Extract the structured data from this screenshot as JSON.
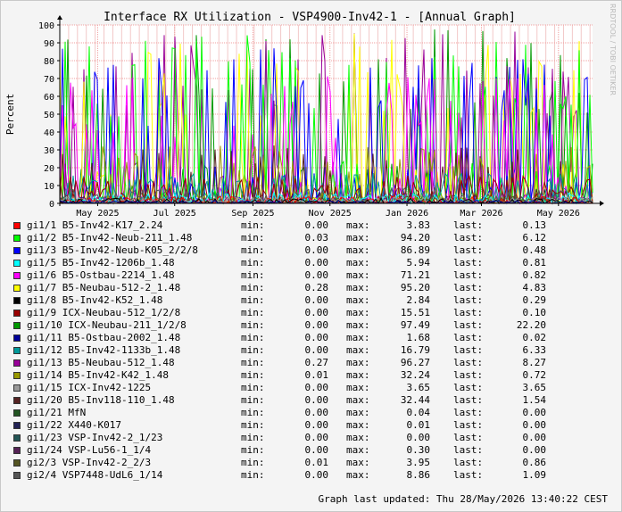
{
  "chart_data": {
    "type": "line",
    "title": "Interface RX Utilization - VSP4900-Inv42-1 - [Annual Graph]",
    "ylabel": "Percent",
    "xlabel": "",
    "ylim": [
      0,
      100
    ],
    "y_ticks": [
      0,
      10,
      20,
      30,
      40,
      50,
      60,
      70,
      80,
      90,
      100
    ],
    "x_ticks": [
      "May 2025",
      "Jul 2025",
      "Sep 2025",
      "Nov 2025",
      "Jan 2026",
      "Mar 2026",
      "May 2026"
    ],
    "x_range": [
      "2025-04-01",
      "2026-05-28"
    ],
    "grid": true,
    "watermark": "RRDTOOL / TOBI OETIKER",
    "series": [
      {
        "name": "gi1/1 B5-Inv42-K17_2.24",
        "color": "#ff0000",
        "min": "0.00",
        "max": "3.83",
        "last": "0.13"
      },
      {
        "name": "gi1/2 B5-Inv42-Neub-211_1.48",
        "color": "#00ff00",
        "min": "0.03",
        "max": "94.20",
        "last": "6.12"
      },
      {
        "name": "gi1/3 B5-Inv42-Neub-K05_2/2/8",
        "color": "#0000ff",
        "min": "0.00",
        "max": "86.89",
        "last": "0.48"
      },
      {
        "name": "gi1/5 B5-Inv42-1206b_1.48",
        "color": "#00ffff",
        "min": "0.00",
        "max": "5.94",
        "last": "0.81"
      },
      {
        "name": "gi1/6 B5-Ostbau-2214_1.48",
        "color": "#ff00ff",
        "min": "0.00",
        "max": "71.21",
        "last": "0.82"
      },
      {
        "name": "gi1/7 B5-Neubau-512-2_1.48",
        "color": "#ffff00",
        "min": "0.28",
        "max": "95.20",
        "last": "4.83"
      },
      {
        "name": "gi1/8 B5-Inv42-K52_1.48",
        "color": "#000000",
        "min": "0.00",
        "max": "2.84",
        "last": "0.29"
      },
      {
        "name": "gi1/9 ICX-Neubau-512_1/2/8",
        "color": "#990000",
        "min": "0.00",
        "max": "15.51",
        "last": "0.10"
      },
      {
        "name": "gi1/10 ICX-Neubau-211_1/2/8",
        "color": "#009900",
        "min": "0.00",
        "max": "97.49",
        "last": "22.20"
      },
      {
        "name": "gi1/11 B5-Ostbau-2002_1.48",
        "color": "#000099",
        "min": "0.00",
        "max": "1.68",
        "last": "0.02"
      },
      {
        "name": "gi1/12 B5-Inv42-1133b_1.48",
        "color": "#009999",
        "min": "0.00",
        "max": "16.79",
        "last": "6.33"
      },
      {
        "name": "gi1/13 B5-Neubau-512_1.48",
        "color": "#990099",
        "min": "0.27",
        "max": "96.27",
        "last": "8.27"
      },
      {
        "name": "gi1/14 B5-Inv42-K42_1.48",
        "color": "#999900",
        "min": "0.01",
        "max": "32.24",
        "last": "0.72"
      },
      {
        "name": "gi1/15 ICX-Inv42-1225",
        "color": "#999999",
        "min": "0.00",
        "max": "3.65",
        "last": "3.65"
      },
      {
        "name": "gi1/20 B5-Inv118-110_1.48",
        "color": "#552222",
        "min": "0.00",
        "max": "32.44",
        "last": "1.54"
      },
      {
        "name": "gi1/21 MfN",
        "color": "#225522",
        "min": "0.00",
        "max": "0.04",
        "last": "0.00"
      },
      {
        "name": "gi1/22 X440-K017",
        "color": "#222255",
        "min": "0.00",
        "max": "0.01",
        "last": "0.00"
      },
      {
        "name": "gi1/23 VSP-Inv42-2_1/23",
        "color": "#225555",
        "min": "0.00",
        "max": "0.00",
        "last": "0.00"
      },
      {
        "name": "gi1/24 VSP-Lu56-1_1/4",
        "color": "#552255",
        "min": "0.00",
        "max": "0.30",
        "last": "0.00"
      },
      {
        "name": "gi2/3 VSP-Inv42-2_2/3",
        "color": "#555522",
        "min": "0.01",
        "max": "3.95",
        "last": "0.86"
      },
      {
        "name": "gi2/4 VSP7448-UdL6_1/14",
        "color": "#555555",
        "min": "0.00",
        "max": "8.86",
        "last": "1.09"
      }
    ]
  },
  "legend_labels": {
    "min": "min:",
    "max": "max:",
    "last": "last:"
  },
  "footer": {
    "updated": "Graph last updated: Thu 28/May/2026 13:40:22 CEST"
  }
}
